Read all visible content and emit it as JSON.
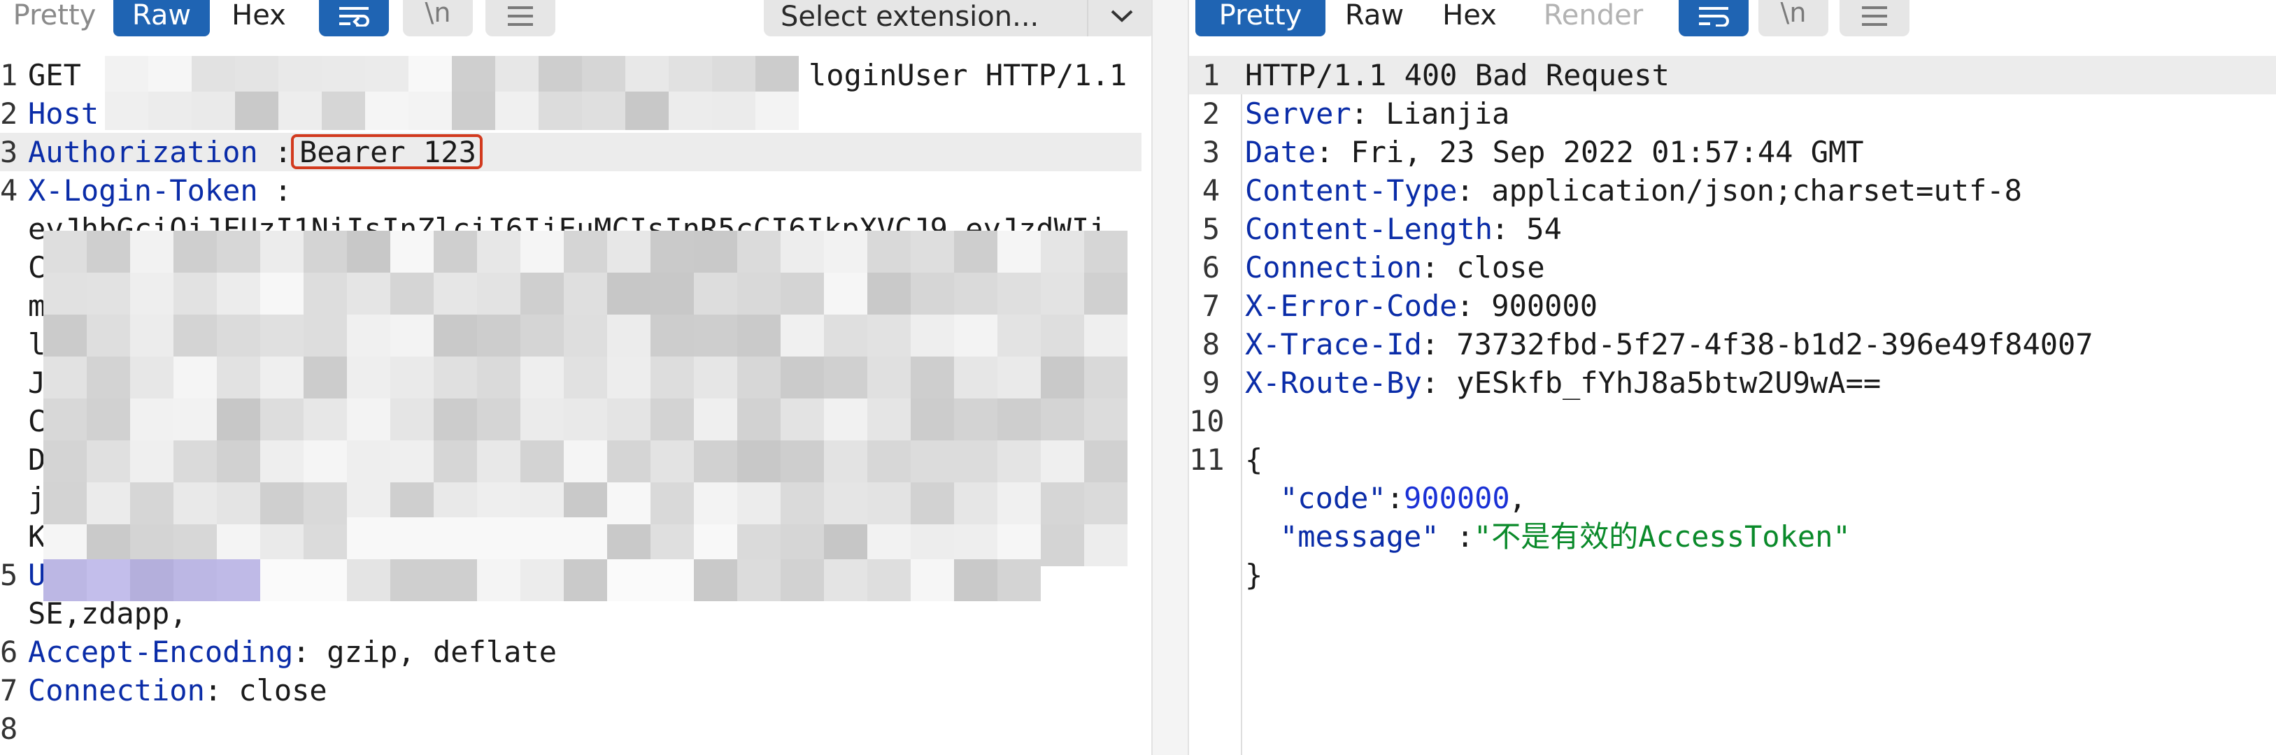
{
  "request_pane": {
    "view_tabs": [
      "Pretty",
      "Raw",
      "Hex"
    ],
    "active_tab": "Raw",
    "wrap_icon": "wrap-lines-icon",
    "newline_button_label": "\\n",
    "menu_icon": "hamburger-menu-icon",
    "extension_select": {
      "value": "Select extension...",
      "icon": "chevron-down-icon"
    },
    "lines": [
      {
        "num": "1",
        "key": "",
        "value": "GET",
        "tail": "loginUser HTTP/1.1"
      },
      {
        "num": "2",
        "key": "Host",
        "value": ""
      },
      {
        "num": "3",
        "key": "Authorization",
        "sep": ":",
        "value": "Bearer 123"
      },
      {
        "num": "4",
        "key": "X-Login-Token",
        "sep": ":",
        "value": ""
      },
      {
        "num": "",
        "value": "eyJhbGciOiJFUzI1NiIsInZlciI6IjEuMCIsInR5cCI6IkpXVCJ9.eyJzdWIi"
      },
      {
        "num": "",
        "value": "C"
      },
      {
        "num": "",
        "value": "m"
      },
      {
        "num": "",
        "value": "l"
      },
      {
        "num": "",
        "value": "J"
      },
      {
        "num": "",
        "value": "C"
      },
      {
        "num": "",
        "value": "D"
      },
      {
        "num": "",
        "value": "j"
      },
      {
        "num": "",
        "value": "K"
      },
      {
        "num": "5",
        "key": "U",
        "value": ""
      },
      {
        "num": "",
        "value": "SE,zdapp,"
      },
      {
        "num": "6",
        "key": "Accept-Encoding",
        "sep": ":",
        "value": " gzip, deflate"
      },
      {
        "num": "7",
        "key": "Connection",
        "sep": ":",
        "value": " close"
      },
      {
        "num": "8",
        "value": ""
      }
    ]
  },
  "response_pane": {
    "view_tabs": [
      "Pretty",
      "Raw",
      "Hex",
      "Render"
    ],
    "active_tab": "Pretty",
    "disabled_tab": "Render",
    "wrap_icon": "wrap-lines-icon",
    "newline_button_label": "\\n",
    "menu_icon": "hamburger-menu-icon",
    "lines": [
      {
        "num": "1",
        "text": "HTTP/1.1 400 Bad Request"
      },
      {
        "num": "2",
        "key": "Server",
        "sep": ":",
        "value": " Lianjia"
      },
      {
        "num": "3",
        "key": "Date",
        "sep": ":",
        "value": " Fri, 23 Sep 2022 01:57:44 GMT"
      },
      {
        "num": "4",
        "key": "Content-Type",
        "sep": ":",
        "value": " application/json;charset=utf-8"
      },
      {
        "num": "5",
        "key": "Content-Length",
        "sep": ":",
        "value": " 54"
      },
      {
        "num": "6",
        "key": "Connection",
        "sep": ":",
        "value": " close"
      },
      {
        "num": "7",
        "key": "X-Error-Code",
        "sep": ":",
        "value": " 900000"
      },
      {
        "num": "8",
        "key": "X-Trace-Id",
        "sep": ":",
        "value": " 73732fbd-5f27-4f38-b1d2-396e49f84007"
      },
      {
        "num": "9",
        "key": "X-Route-By",
        "sep": ":",
        "value": " yESkfb_fYhJ8a5btw2U9wA=="
      },
      {
        "num": "10",
        "text": ""
      },
      {
        "num": "11",
        "text": "{"
      },
      {
        "num": "",
        "json_key": "\"code\"",
        "sep": ":",
        "json_num": "900000",
        "tail": ","
      },
      {
        "num": "",
        "json_key": "\"message\"",
        "sep": ":",
        "json_str": "\"不是有效的AccessToken\""
      },
      {
        "num": "",
        "text": "}"
      }
    ]
  },
  "colors": {
    "active_tab": "#1f64b3",
    "header_key": "#0a2ca8",
    "json_number": "#1a31d6",
    "json_string": "#0a8a2a",
    "highlight_box": "#d23a1e"
  }
}
